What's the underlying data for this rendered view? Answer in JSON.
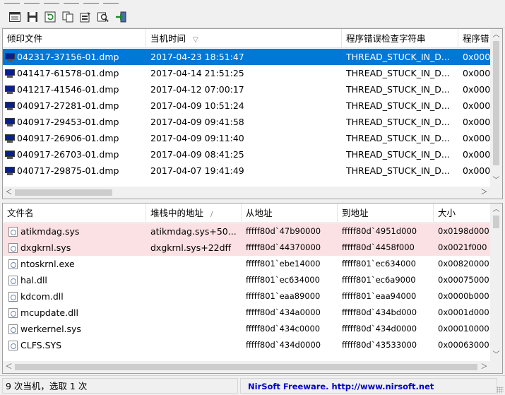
{
  "toolbar": {
    "icons": [
      "properties-icon",
      "save-icon",
      "refresh-icon",
      "copy-icon",
      "settings-icon",
      "find-icon",
      "exit-icon"
    ]
  },
  "crashes": {
    "columns": [
      "倾印文件",
      "当机时间",
      "程序错误检查字符串",
      "程序错"
    ],
    "sort_mark": "▽",
    "rows": [
      {
        "file": "042317-37156-01.dmp",
        "time": "2017-04-23 18:51:47",
        "bugcheck": "THREAD_STUCK_IN_D...",
        "code": "0x000",
        "selected": true
      },
      {
        "file": "041417-61578-01.dmp",
        "time": "2017-04-14 21:51:25",
        "bugcheck": "THREAD_STUCK_IN_D...",
        "code": "0x000"
      },
      {
        "file": "041217-41546-01.dmp",
        "time": "2017-04-12 07:00:17",
        "bugcheck": "THREAD_STUCK_IN_D...",
        "code": "0x000"
      },
      {
        "file": "040917-27281-01.dmp",
        "time": "2017-04-09 10:51:24",
        "bugcheck": "THREAD_STUCK_IN_D...",
        "code": "0x000"
      },
      {
        "file": "040917-29453-01.dmp",
        "time": "2017-04-09 09:41:58",
        "bugcheck": "THREAD_STUCK_IN_D...",
        "code": "0x000"
      },
      {
        "file": "040917-26906-01.dmp",
        "time": "2017-04-09 09:11:40",
        "bugcheck": "THREAD_STUCK_IN_D...",
        "code": "0x000"
      },
      {
        "file": "040917-26703-01.dmp",
        "time": "2017-04-09 08:41:25",
        "bugcheck": "THREAD_STUCK_IN_D...",
        "code": "0x000"
      },
      {
        "file": "040717-29875-01.dmp",
        "time": "2017-04-07 19:41:49",
        "bugcheck": "THREAD_STUCK_IN_D...",
        "code": "0x000"
      }
    ]
  },
  "modules": {
    "columns": [
      "文件名",
      "堆栈中的地址",
      "从地址",
      "到地址",
      "大小"
    ],
    "sort_mark": "/",
    "rows": [
      {
        "name": "atikmdag.sys",
        "stack": "atikmdag.sys+50...",
        "from": "fffff80d`47b90000",
        "to": "fffff80d`4951d000",
        "size": "0x0198d000",
        "highlight": true
      },
      {
        "name": "dxgkrnl.sys",
        "stack": "dxgkrnl.sys+22dff",
        "from": "fffff80d`44370000",
        "to": "fffff80d`4458f000",
        "size": "0x0021f000",
        "highlight": true
      },
      {
        "name": "ntoskrnl.exe",
        "stack": "",
        "from": "fffff801`ebe14000",
        "to": "fffff801`ec634000",
        "size": "0x00820000"
      },
      {
        "name": "hal.dll",
        "stack": "",
        "from": "fffff801`ec634000",
        "to": "fffff801`ec6a9000",
        "size": "0x00075000"
      },
      {
        "name": "kdcom.dll",
        "stack": "",
        "from": "fffff801`eaa89000",
        "to": "fffff801`eaa94000",
        "size": "0x0000b000"
      },
      {
        "name": "mcupdate.dll",
        "stack": "",
        "from": "fffff80d`434a0000",
        "to": "fffff80d`434bd000",
        "size": "0x0001d000"
      },
      {
        "name": "werkernel.sys",
        "stack": "",
        "from": "fffff80d`434c0000",
        "to": "fffff80d`434d0000",
        "size": "0x00010000"
      },
      {
        "name": "CLFS.SYS",
        "stack": "",
        "from": "fffff80d`434d0000",
        "to": "fffff80d`43533000",
        "size": "0x00063000"
      }
    ]
  },
  "status": {
    "summary": "9 次当机，选取 1 次",
    "credit": "NirSoft Freeware.  http://www.nirsoft.net"
  },
  "colors": {
    "selection": "#0078d7",
    "highlight": "#fbe1e3",
    "link": "#0000c8"
  }
}
